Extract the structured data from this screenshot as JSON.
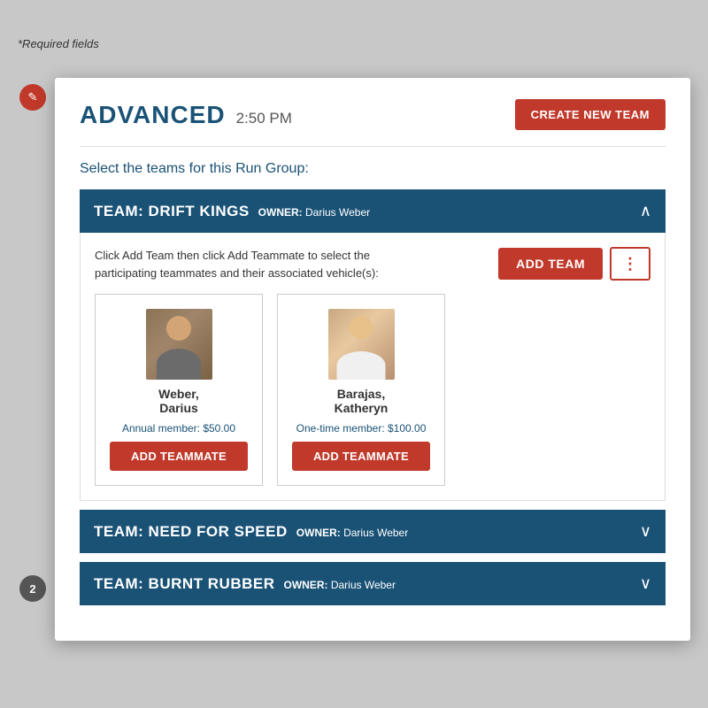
{
  "page": {
    "required_fields_label": "*Required fields",
    "step_badge": "2"
  },
  "modal": {
    "title": "ADVANCED",
    "time": "2:50 PM",
    "create_new_team_label": "CREATE NEW TEAM",
    "divider": true,
    "select_label": "Select the teams for this Run Group:",
    "teams": [
      {
        "id": "drift-kings",
        "name": "TEAM: DRIFT KINGS",
        "owner_label": "OWNER:",
        "owner_name": "Darius Weber",
        "expanded": true,
        "description": "Click Add Team then click Add Teammate to select the participating teammates and their associated vehicle(s):",
        "add_team_label": "ADD TEAM",
        "more_label": "⋮",
        "teammates": [
          {
            "name": "Weber,\nDarius",
            "membership": "Annual member: $50.00",
            "add_label": "ADD TEAMMATE",
            "gender": "male"
          },
          {
            "name": "Barajas,\nKatheryn",
            "membership": "One-time member: $100.00",
            "add_label": "ADD TEAMMATE",
            "gender": "female"
          }
        ]
      },
      {
        "id": "need-for-speed",
        "name": "TEAM: NEED FOR SPEED",
        "owner_label": "OWNER:",
        "owner_name": "Darius Weber",
        "expanded": false
      },
      {
        "id": "burnt-rubber",
        "name": "TEAM: BURNT RUBBER",
        "owner_label": "OWNER:",
        "owner_name": "Darius Weber",
        "expanded": false
      }
    ]
  },
  "icons": {
    "edit": "✎",
    "chevron_up": "∧",
    "chevron_down": "∨",
    "more": "⋮"
  },
  "colors": {
    "primary_blue": "#1a5276",
    "primary_red": "#c0392b",
    "white": "#ffffff"
  }
}
